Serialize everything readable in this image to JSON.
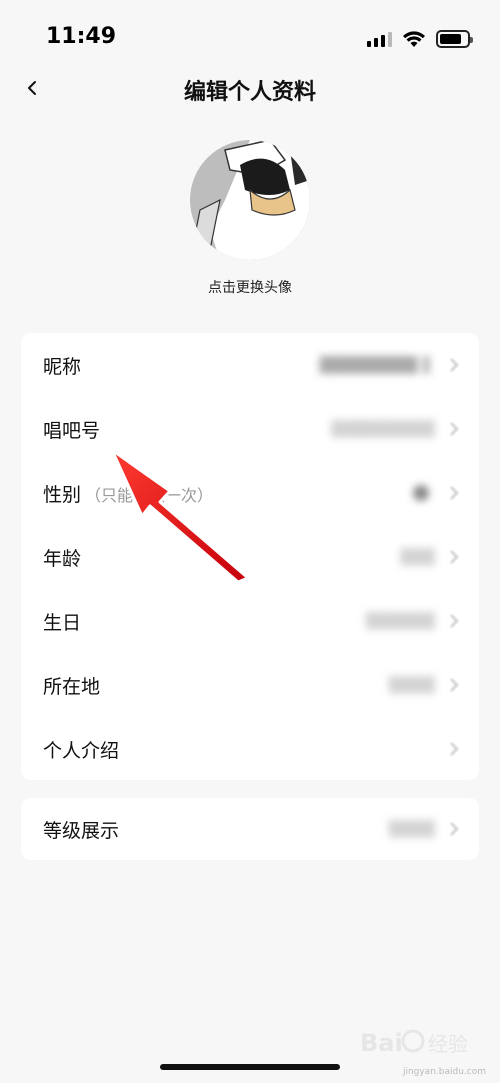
{
  "status_bar": {
    "time": "11:49",
    "icons": [
      "cellular-signal-icon",
      "wifi-icon",
      "battery-icon"
    ]
  },
  "navbar": {
    "back_icon": "chevron-left-icon",
    "title": "编辑个人资料"
  },
  "avatar": {
    "hint": "点击更换头像"
  },
  "profile_rows": [
    {
      "label": "昵称",
      "value": ""
    },
    {
      "label": "唱吧号",
      "value": ""
    },
    {
      "label": "性别",
      "note": "（只能修改一次）",
      "value": ""
    },
    {
      "label": "年龄",
      "value": ""
    },
    {
      "label": "生日",
      "value": ""
    },
    {
      "label": "所在地",
      "value": ""
    },
    {
      "label": "个人介绍",
      "value": ""
    }
  ],
  "level_row": {
    "label": "等级展示",
    "value": ""
  },
  "annotation": {
    "type": "red-arrow",
    "color": "#e41a1c",
    "points_to": "唱吧号"
  },
  "watermark": {
    "text": "Bai 经验",
    "subtext": "jingyan.baidu.com"
  },
  "colors": {
    "background": "#f7f7f7",
    "card": "#ffffff",
    "arrow": "#e41a1c"
  }
}
